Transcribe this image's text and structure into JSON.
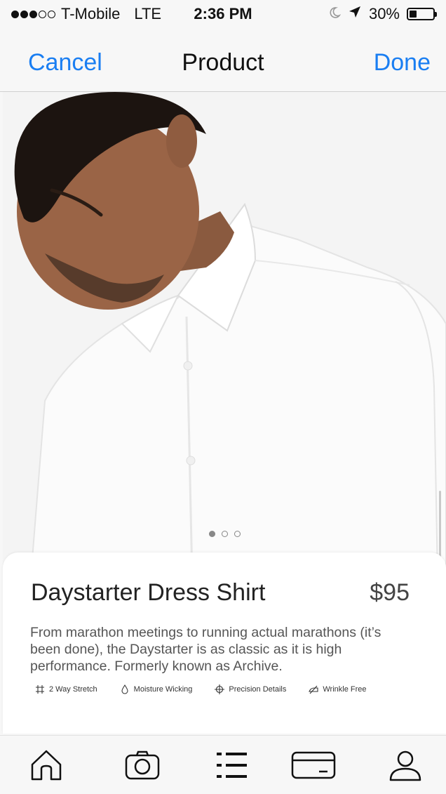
{
  "status_bar": {
    "carrier": "T-Mobile",
    "network": "LTE",
    "time": "2:36 PM",
    "battery_percent_label": "30%",
    "battery_level": 0.3,
    "signal_bars_filled": 3,
    "signal_bars_total": 5
  },
  "nav": {
    "cancel_label": "Cancel",
    "title": "Product",
    "done_label": "Done"
  },
  "gallery": {
    "page_count": 3,
    "current_page": 1
  },
  "product": {
    "name": "Daystarter Dress Shirt",
    "price": "$95",
    "description": "From marathon meetings to running actual marathons (it’s been done), the Daystarter is as classic as it is high performance. Formerly known as Archive.",
    "features": [
      {
        "label": "2 Way Stretch",
        "icon": "stretch-grid-icon"
      },
      {
        "label": "Moisture Wicking",
        "icon": "droplet-icon"
      },
      {
        "label": "Precision Details",
        "icon": "crosshair-icon"
      },
      {
        "label": "Wrinkle Free",
        "icon": "iron-icon"
      }
    ]
  },
  "tab_bar": {
    "tabs": [
      {
        "name": "home",
        "icon": "home-icon"
      },
      {
        "name": "camera",
        "icon": "camera-icon"
      },
      {
        "name": "list",
        "icon": "list-icon"
      },
      {
        "name": "card",
        "icon": "credit-card-icon"
      },
      {
        "name": "profile",
        "icon": "user-icon"
      }
    ]
  },
  "colors": {
    "accent": "#1a7ef2",
    "background": "#f7f7f7",
    "card": "#ffffff"
  }
}
